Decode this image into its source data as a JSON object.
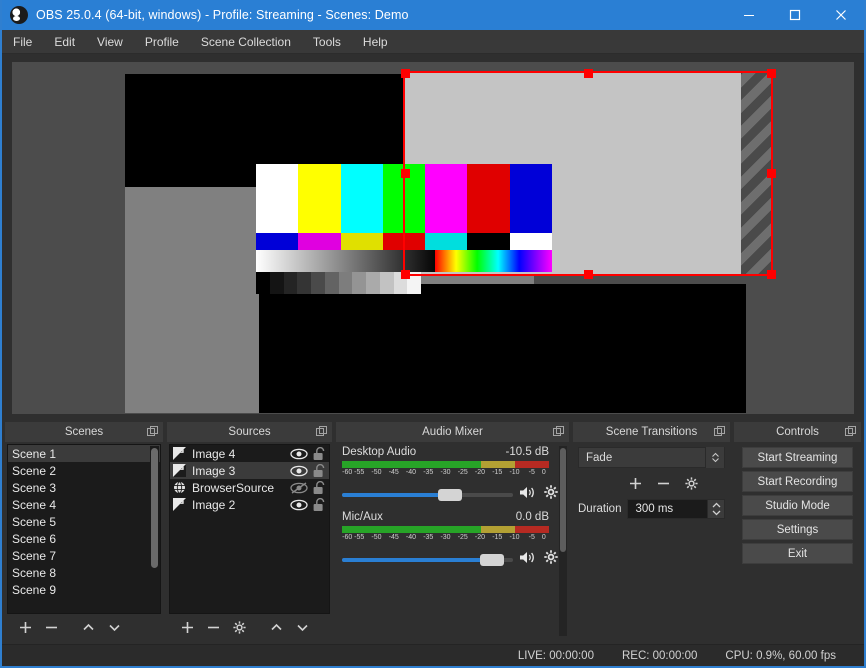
{
  "window": {
    "title": "OBS 25.0.4 (64-bit, windows) - Profile: Streaming - Scenes: Demo",
    "logo_icon": "obs-logo-icon",
    "minimize_icon": "minimize-icon",
    "maximize_icon": "maximize-icon",
    "close_icon": "close-icon",
    "titlebar_color": "#2a7fd4",
    "border_color": "#2f7fd0"
  },
  "menubar": {
    "items": [
      {
        "label": "File"
      },
      {
        "label": "Edit"
      },
      {
        "label": "View"
      },
      {
        "label": "Profile"
      },
      {
        "label": "Scene Collection"
      },
      {
        "label": "Tools"
      },
      {
        "label": "Help"
      }
    ]
  },
  "preview": {
    "name": "preview-canvas",
    "selection_color": "#ff0000",
    "backdrop_color": "#4c4c4c",
    "color_bars": [
      "#ffffff",
      "#ffff00",
      "#00ffff",
      "#00ff00",
      "#ff00ff",
      "#e00000",
      "#0000d8"
    ],
    "lower_bars": [
      "#0000d8",
      "#e000e0",
      "#e0e000",
      "#e00000",
      "#00dede",
      "#000000",
      "#ffffff"
    ],
    "gray_steps": [
      "#000000",
      "#141414",
      "#242424",
      "#343434",
      "#4a4a4a",
      "#636363",
      "#7d7d7d",
      "#949494",
      "#aaaaaa",
      "#c2c2c2",
      "#dcdcdc",
      "#f4f4f4"
    ]
  },
  "scenes": {
    "title": "Scenes",
    "float_icon": "undock-icon",
    "selected_index": 0,
    "items": [
      {
        "label": "Scene 1"
      },
      {
        "label": "Scene 2"
      },
      {
        "label": "Scene 3"
      },
      {
        "label": "Scene 4"
      },
      {
        "label": "Scene 5"
      },
      {
        "label": "Scene 6"
      },
      {
        "label": "Scene 7"
      },
      {
        "label": "Scene 8"
      },
      {
        "label": "Scene 9"
      }
    ],
    "toolbar": {
      "add_icon": "plus-icon",
      "remove_icon": "minus-icon",
      "up_icon": "chevron-up-icon",
      "down_icon": "chevron-down-icon"
    }
  },
  "sources": {
    "title": "Sources",
    "float_icon": "undock-icon",
    "selected_index": 1,
    "items": [
      {
        "label": "Image 4",
        "type": "image",
        "visible": true,
        "locked": false
      },
      {
        "label": "Image 3",
        "type": "image",
        "visible": true,
        "locked": false
      },
      {
        "label": "BrowserSource",
        "type": "browser",
        "visible": false,
        "locked": false
      },
      {
        "label": "Image 2",
        "type": "image",
        "visible": true,
        "locked": false
      }
    ],
    "toolbar": {
      "add_icon": "plus-icon",
      "remove_icon": "minus-icon",
      "properties_icon": "gear-icon",
      "up_icon": "chevron-up-icon",
      "down_icon": "chevron-down-icon"
    }
  },
  "mixer": {
    "title": "Audio Mixer",
    "float_icon": "undock-icon",
    "tick_labels": [
      "-60",
      "-55",
      "-50",
      "-45",
      "-40",
      "-35",
      "-30",
      "-25",
      "-20",
      "-15",
      "-10",
      "-5",
      "0"
    ],
    "tracks": [
      {
        "name": "Desktop Audio",
        "level": "-10.5 dB",
        "volume_percent": 63,
        "mute_icon": "speaker-icon",
        "settings_icon": "gear-icon"
      },
      {
        "name": "Mic/Aux",
        "level": "0.0 dB",
        "volume_percent": 88,
        "mute_icon": "speaker-icon",
        "settings_icon": "gear-icon"
      }
    ],
    "meter_colors": {
      "green": "#27a427",
      "yellow": "#b3a033",
      "red": "#b62a22"
    }
  },
  "transitions": {
    "title": "Scene Transitions",
    "float_icon": "undock-icon",
    "selected_transition": "Fade",
    "dropdown_icon": "updown-arrows-icon",
    "add_icon": "plus-icon",
    "remove_icon": "minus-icon",
    "properties_icon": "gear-icon",
    "duration_label": "Duration",
    "duration_value": "300 ms",
    "spin_up_icon": "chevron-up-icon",
    "spin_down_icon": "chevron-down-icon"
  },
  "controls": {
    "title": "Controls",
    "float_icon": "undock-icon",
    "buttons": [
      {
        "label": "Start Streaming"
      },
      {
        "label": "Start Recording"
      },
      {
        "label": "Studio Mode"
      },
      {
        "label": "Settings"
      },
      {
        "label": "Exit"
      }
    ]
  },
  "statusbar": {
    "live": "LIVE: 00:00:00",
    "rec": "REC: 00:00:00",
    "cpu": "CPU: 0.9%, 60.00 fps"
  }
}
